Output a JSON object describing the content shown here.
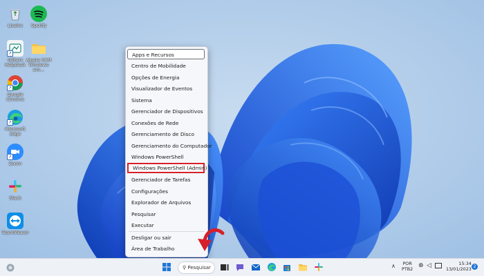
{
  "desktop": {
    "icons": [
      {
        "label": "Lixeira",
        "icon": "recycle-bin-icon"
      },
      {
        "label": "Spotify",
        "icon": "spotify-icon"
      },
      {
        "label": "Gilbert Helpdesk",
        "icon": "helpdesk-icon"
      },
      {
        "label": "Ajuste SAM Windows em...",
        "icon": "folder-icon"
      },
      {
        "label": "Google Chrome",
        "icon": "chrome-icon"
      },
      {
        "label": "Microsoft Edge",
        "icon": "edge-icon"
      },
      {
        "label": "Zoom",
        "icon": "zoom-icon"
      },
      {
        "label": "Slack",
        "icon": "slack-icon"
      },
      {
        "label": "TeamViewer",
        "icon": "teamviewer-icon"
      }
    ]
  },
  "context_menu": {
    "items": [
      "Apps e Recursos",
      "Centro de Mobilidade",
      "Opções de Energia",
      "Visualizador de Eventos",
      "Sistema",
      "Gerenciador de Dispositivos",
      "Conexões de Rede",
      "Gerenciamento de Disco",
      "Gerenciamento do Computador",
      "Windows PowerShell",
      "Windows PowerShell (Admin)",
      "Gerenciador de Tarefas",
      "Configurações",
      "Explorador de Arquivos",
      "Pesquisar",
      "Executar",
      "Desligar ou sair",
      "Área de Trabalho"
    ],
    "highlighted_item": "Windows PowerShell (Admin)",
    "highlight_color": "#d6202a"
  },
  "taskbar": {
    "search_label": "Pesquisar",
    "pinned_icons": [
      "start-icon",
      "file-icon",
      "chat-icon",
      "mail-icon",
      "edge-icon",
      "store-icon",
      "explorer-icon",
      "slack-icon"
    ],
    "language_line1": "POR",
    "language_line2": "PTB2",
    "time": "15:34",
    "date": "13/01/2023",
    "notification_count": "2"
  },
  "annotation": {
    "arrow_color": "#d6202a"
  }
}
